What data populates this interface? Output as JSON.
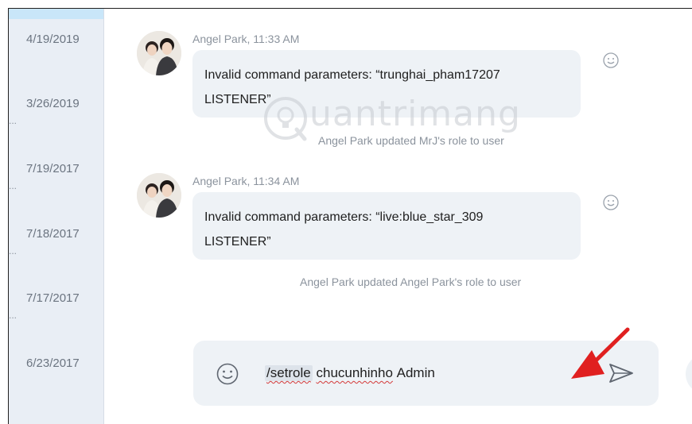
{
  "sidebar": {
    "items": [
      {
        "date": "4/19/2019",
        "dots": ""
      },
      {
        "date": "3/26/2019",
        "dots": "..."
      },
      {
        "date": "7/19/2017",
        "dots": "..."
      },
      {
        "date": "7/18/2017",
        "dots": "..."
      },
      {
        "date": "7/17/2017",
        "dots": "..."
      },
      {
        "date": "6/23/2017",
        "dots": ""
      }
    ]
  },
  "messages": [
    {
      "sender": "Angel Park, 11:33 AM",
      "lines": [
        "Invalid command parameters: “trunghai_pham17207",
        "LISTENER”"
      ],
      "system": "Angel Park updated MrJ's role to user"
    },
    {
      "sender": "Angel Park, 11:34 AM",
      "lines": [
        "Invalid command parameters: “live:blue_star_309",
        "LISTENER”"
      ],
      "system": "Angel Park updated Angel Park's role to user"
    }
  ],
  "composer": {
    "command": "/setrole",
    "username": "chucunhinho",
    "role": "Admin"
  },
  "watermark": {
    "text": "uantrimang"
  },
  "colors": {
    "accent_arrow": "#e02020",
    "bubble_bg": "#eef2f6",
    "sidebar_bg": "#e9eef5",
    "sidebar_top_bar": "#c9e6f9",
    "muted_text": "#8b939d"
  },
  "icons": {
    "message_reaction": "smiley-icon",
    "composer_emoji": "emoji-icon",
    "send": "send-icon"
  }
}
